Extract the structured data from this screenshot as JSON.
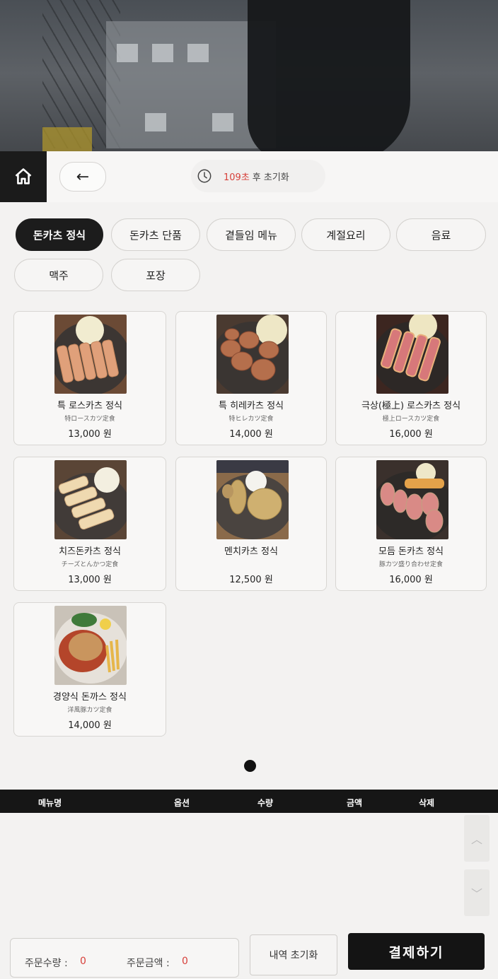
{
  "timer": {
    "seconds": "109초",
    "suffix": "후 초기화"
  },
  "categories": [
    {
      "label": "돈카츠 정식",
      "active": true
    },
    {
      "label": "돈카츠 단품"
    },
    {
      "label": "곁들임 메뉴"
    },
    {
      "label": "계절요리"
    },
    {
      "label": "음료"
    },
    {
      "label": "맥주"
    },
    {
      "label": "포장"
    }
  ],
  "menu_items": [
    {
      "name": "특 로스카츠 정식",
      "sub": "特ロースカツ定食",
      "price": "13,000 원"
    },
    {
      "name": "특 히레카츠 정식",
      "sub": "特ヒレカツ定食",
      "price": "14,000 원"
    },
    {
      "name": "극상(極上) 로스카츠 정식",
      "sub": "極上ロースカツ定食",
      "price": "16,000 원"
    },
    {
      "name": "치즈돈카츠 정식",
      "sub": "チーズとんかつ定食",
      "price": "13,000 원"
    },
    {
      "name": "멘치카츠 정식",
      "sub": "",
      "price": "12,500 원"
    },
    {
      "name": "모듬 돈카츠 정식",
      "sub": "豚カツ盛り合わせ定食",
      "price": "16,000 원"
    },
    {
      "name": "경양식 돈까스 정식",
      "sub": "洋風豚カツ定食",
      "price": "14,000 원"
    }
  ],
  "order_table": {
    "col_menu": "메뉴명",
    "col_option": "옵션",
    "col_qty": "수량",
    "col_amount": "금액",
    "col_delete": "삭제"
  },
  "summary": {
    "qty_label": "주문수량 :",
    "qty_value": "0",
    "amount_label": "주문금액 :",
    "amount_value": "0"
  },
  "buttons": {
    "back": "←",
    "reset": "내역 초기화",
    "pay": "결제하기"
  },
  "icons": {
    "home": "home-icon",
    "clock": "clock-icon",
    "scroll_up": "chevron-up-icon",
    "scroll_down": "chevron-down-icon"
  },
  "colors": {
    "accent_red": "#d7403a",
    "dark": "#1c1c1c"
  }
}
